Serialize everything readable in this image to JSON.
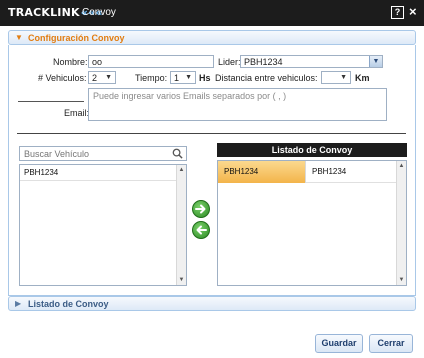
{
  "window": {
    "logo_text": "TRACKLINK",
    "logo_chevrons": "«««",
    "title": "Convoy",
    "help_label": "?",
    "close_label": "×"
  },
  "config_panel": {
    "title": "Configuración Convoy",
    "nombre_label": "Nombre:",
    "nombre_value": "oo",
    "lider_label": "Lider:",
    "lider_value": "PBH1234",
    "vehiculos_label": "# Vehiculos:",
    "vehiculos_value": "2",
    "tiempo_label": "Tiempo:",
    "tiempo_value": "1",
    "tiempo_unit": "Hs",
    "distancia_label": "Distancia entre vehiculos:",
    "distancia_value": "",
    "distancia_unit": "Km",
    "email_label": "Email:",
    "email_placeholder": "Puede ingresar varios Emails separados por ( , )"
  },
  "left_list": {
    "search_placeholder": "Buscar Vehículo",
    "items": [
      "PBH1234"
    ]
  },
  "right_list": {
    "title": "Listado de Convoy",
    "rows": [
      {
        "col1": "PBH1234",
        "col2": "PBH1234"
      }
    ]
  },
  "collapsed_panel": {
    "title": "Listado de Convoy"
  },
  "footer": {
    "save_label": "Guardar",
    "close_label": "Cerrar"
  },
  "colors": {
    "titlebar": "#1c1c1c",
    "accent_orange": "#e27d12",
    "selected_row": "#f3b44a",
    "arrow_green": "#2c8b24"
  }
}
